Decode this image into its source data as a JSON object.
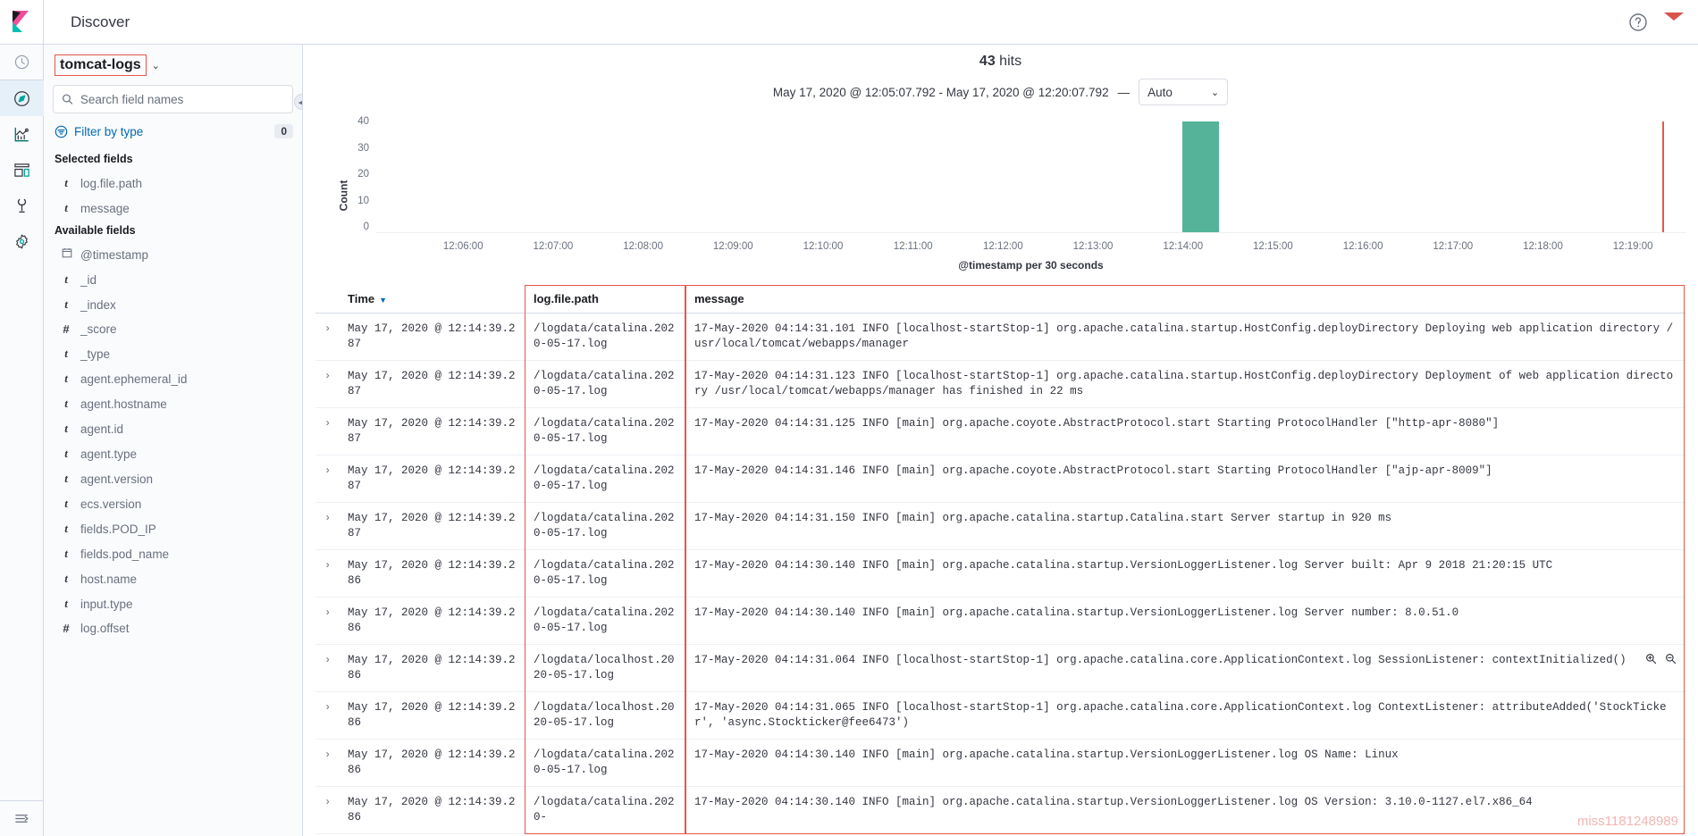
{
  "topbar": {
    "app_title": "Discover",
    "help_icon": "question-circle-icon",
    "mail_icon": "mail-icon"
  },
  "rail": {
    "items": [
      {
        "name": "recently-viewed",
        "icon": "clock-icon"
      },
      {
        "name": "discover",
        "icon": "compass-icon",
        "active": true
      },
      {
        "name": "visualize",
        "icon": "chart-icon"
      },
      {
        "name": "dashboard",
        "icon": "dashboard-icon"
      },
      {
        "name": "dev-tools",
        "icon": "wrench-icon"
      },
      {
        "name": "management",
        "icon": "gear-icon"
      }
    ],
    "bottom_icon": "collapse-nav-icon"
  },
  "sidebar": {
    "index_pattern": "tomcat-logs",
    "index_caret": "⌄",
    "search": {
      "placeholder": "Search field names",
      "value": "",
      "icon": "search-icon"
    },
    "filter_by_type": {
      "label": "Filter by type",
      "count": "0",
      "icon": "filter-icon"
    },
    "selected_fields_title": "Selected fields",
    "selected_fields": [
      {
        "name": "log.file.path",
        "type": "t"
      },
      {
        "name": "message",
        "type": "t"
      }
    ],
    "available_fields_title": "Available fields",
    "available_fields": [
      {
        "name": "@timestamp",
        "type": "date"
      },
      {
        "name": "_id",
        "type": "t"
      },
      {
        "name": "_index",
        "type": "t"
      },
      {
        "name": "_score",
        "type": "#"
      },
      {
        "name": "_type",
        "type": "t"
      },
      {
        "name": "agent.ephemeral_id",
        "type": "t"
      },
      {
        "name": "agent.hostname",
        "type": "t"
      },
      {
        "name": "agent.id",
        "type": "t"
      },
      {
        "name": "agent.type",
        "type": "t"
      },
      {
        "name": "agent.version",
        "type": "t"
      },
      {
        "name": "ecs.version",
        "type": "t"
      },
      {
        "name": "fields.POD_IP",
        "type": "t"
      },
      {
        "name": "fields.pod_name",
        "type": "t"
      },
      {
        "name": "host.name",
        "type": "t"
      },
      {
        "name": "input.type",
        "type": "t"
      },
      {
        "name": "log.offset",
        "type": "#"
      }
    ],
    "collapse_icon": "◀"
  },
  "main": {
    "hits_count": "43",
    "hits_label": "hits",
    "time_range": "May 17, 2020 @ 12:05:07.792 - May 17, 2020 @ 12:20:07.792",
    "range_dash": "—",
    "interval": {
      "value": "Auto",
      "caret": "⌄"
    }
  },
  "chart_data": {
    "type": "bar",
    "title": "",
    "xlabel": "@timestamp per 30 seconds",
    "ylabel": "Count",
    "ylim": [
      0,
      40
    ],
    "yticks": [
      40,
      30,
      20,
      10,
      0
    ],
    "xticks": [
      "12:06:00",
      "12:07:00",
      "12:08:00",
      "12:09:00",
      "12:10:00",
      "12:11:00",
      "12:12:00",
      "12:13:00",
      "12:14:00",
      "12:15:00",
      "12:16:00",
      "12:17:00",
      "12:18:00",
      "12:19:00"
    ],
    "bar_color": "#54b399",
    "grid": false,
    "legend": "none",
    "categories": [
      "12:14:30"
    ],
    "values": [
      43
    ],
    "bars": [
      {
        "x_pct": 61.6,
        "width_pct": 2.75,
        "value": 43
      }
    ],
    "end_marker_pct": 98.2
  },
  "table": {
    "columns": [
      {
        "key": "time",
        "label": "Time",
        "sorted": true,
        "sort_caret": "▼"
      },
      {
        "key": "path",
        "label": "log.file.path",
        "highlighted": true
      },
      {
        "key": "message",
        "label": "message",
        "highlighted": true
      }
    ],
    "expand_icon": "›",
    "row_actions": {
      "zoom_in": "zoom-in-icon",
      "zoom_out": "zoom-out-icon"
    },
    "rows": [
      {
        "time": "May 17, 2020 @ 12:14:39.287",
        "path": "/logdata/catalina.2020-05-17.log",
        "message": "17-May-2020 04:14:31.101 INFO [localhost-startStop-1] org.apache.catalina.startup.HostConfig.deployDirectory Deploying web application directory /usr/local/tomcat/webapps/manager"
      },
      {
        "time": "May 17, 2020 @ 12:14:39.287",
        "path": "/logdata/catalina.2020-05-17.log",
        "message": "17-May-2020 04:14:31.123 INFO [localhost-startStop-1] org.apache.catalina.startup.HostConfig.deployDirectory Deployment of web application directory /usr/local/tomcat/webapps/manager has finished in 22 ms"
      },
      {
        "time": "May 17, 2020 @ 12:14:39.287",
        "path": "/logdata/catalina.2020-05-17.log",
        "message": "17-May-2020 04:14:31.125 INFO [main] org.apache.coyote.AbstractProtocol.start Starting ProtocolHandler [\"http-apr-8080\"]"
      },
      {
        "time": "May 17, 2020 @ 12:14:39.287",
        "path": "/logdata/catalina.2020-05-17.log",
        "message": "17-May-2020 04:14:31.146 INFO [main] org.apache.coyote.AbstractProtocol.start Starting ProtocolHandler [\"ajp-apr-8009\"]"
      },
      {
        "time": "May 17, 2020 @ 12:14:39.287",
        "path": "/logdata/catalina.2020-05-17.log",
        "message": "17-May-2020 04:14:31.150 INFO [main] org.apache.catalina.startup.Catalina.start Server startup in 920 ms"
      },
      {
        "time": "May 17, 2020 @ 12:14:39.286",
        "path": "/logdata/catalina.2020-05-17.log",
        "message": "17-May-2020 04:14:30.140 INFO [main] org.apache.catalina.startup.VersionLoggerListener.log Server built:          Apr 9 2018 21:20:15 UTC"
      },
      {
        "time": "May 17, 2020 @ 12:14:39.286",
        "path": "/logdata/catalina.2020-05-17.log",
        "message": "17-May-2020 04:14:30.140 INFO [main] org.apache.catalina.startup.VersionLoggerListener.log Server number:         8.0.51.0"
      },
      {
        "time": "May 17, 2020 @ 12:14:39.286",
        "path": "/logdata/localhost.2020-05-17.log",
        "message": "17-May-2020 04:14:31.064 INFO [localhost-startStop-1] org.apache.catalina.core.ApplicationContext.log SessionListener: contextInitialized()",
        "show_actions": true
      },
      {
        "time": "May 17, 2020 @ 12:14:39.286",
        "path": "/logdata/localhost.2020-05-17.log",
        "message": "17-May-2020 04:14:31.065 INFO [localhost-startStop-1] org.apache.catalina.core.ApplicationContext.log ContextListener: attributeAdded('StockTicker', 'async.Stockticker@fee6473')"
      },
      {
        "time": "May 17, 2020 @ 12:14:39.286",
        "path": "/logdata/catalina.2020-05-17.log",
        "message": "17-May-2020 04:14:30.140 INFO [main] org.apache.catalina.startup.VersionLoggerListener.log OS Name:               Linux"
      },
      {
        "time": "May 17, 2020 @ 12:14:39.286",
        "path": "/logdata/catalina.2020-",
        "message": "17-May-2020 04:14:30.140 INFO [main] org.apache.catalina.startup.VersionLoggerListener.log OS Version:            3.10.0-1127.el7.x86_64"
      }
    ]
  },
  "watermark": "miss1181248989",
  "colors": {
    "accent": "#006bb4",
    "bar": "#54b399",
    "highlight": "#e7564a",
    "danger": "#bd271e"
  }
}
